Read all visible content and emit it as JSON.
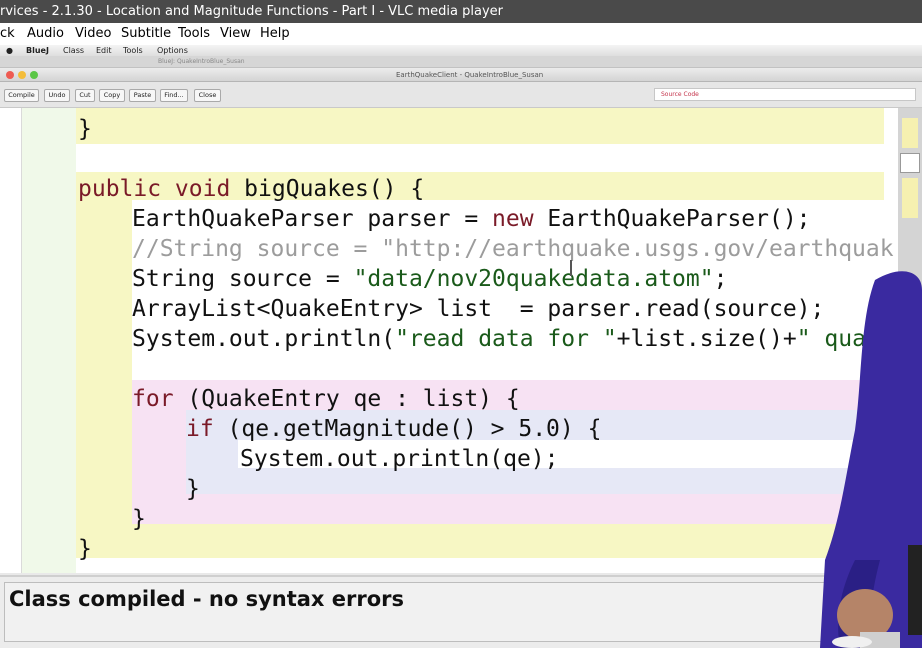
{
  "vlc": {
    "title": "rvices - 2.1.30 - Location and Magnitude Functions - Part I - VLC media player",
    "menu": [
      "ck",
      "Audio",
      "Video",
      "Subtitle",
      "Tools",
      "View",
      "Help"
    ]
  },
  "mac_menu": [
    "BlueJ",
    "Class",
    "Edit",
    "Tools",
    "Options"
  ],
  "back_window_title": "BlueJ: QuakeIntroBlue_Susan",
  "editor": {
    "window_title": "EarthQuakeClient - QuakeIntroBlue_Susan",
    "toolbar": [
      "Compile",
      "Undo",
      "Cut",
      "Copy",
      "Paste",
      "Find...",
      "Close"
    ],
    "view_select": "Source Code",
    "code_lines": [
      "}",
      "",
      "public void bigQuakes() {",
      "EarthQuakeParser parser = new EarthQuakeParser();",
      "//String source = \"http://earthquake.usgs.gov/earthquak",
      "String source = \"data/nov20quakedata.atom\";",
      "ArrayList<QuakeEntry> list  = parser.read(source);",
      "System.out.println(\"read data for \"+list.size()+\" quake",
      "",
      "for (QuakeEntry qe : list) {",
      "if (qe.getMagnitude() > 5.0) {",
      "System.out.println(qe);",
      "}",
      "}",
      "}"
    ]
  },
  "status": "Class compiled - no syntax errors",
  "colors": {
    "class_scope": "#f7f7c4",
    "method_scope": "#f0f9e9",
    "for_scope": "#f7e2f3",
    "if_scope": "#e6e8f6",
    "presenter": "#3a2aa0"
  }
}
